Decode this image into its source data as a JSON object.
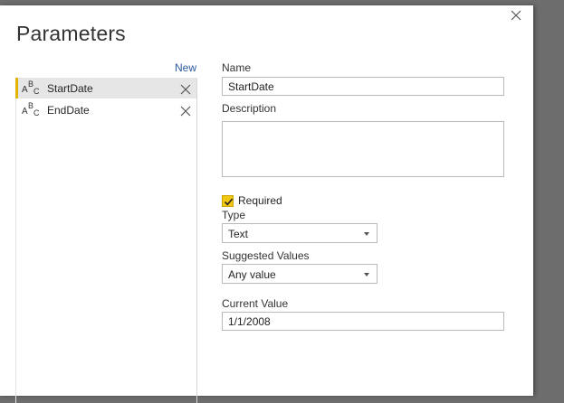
{
  "dialog": {
    "title": "Parameters",
    "new_label": "New"
  },
  "parameters": [
    {
      "name": "StartDate",
      "type_icon": "abc-text-icon",
      "selected": true
    },
    {
      "name": "EndDate",
      "type_icon": "abc-text-icon",
      "selected": false
    }
  ],
  "form": {
    "name_label": "Name",
    "name_value": "StartDate",
    "description_label": "Description",
    "description_value": "",
    "required_label": "Required",
    "required_checked": true,
    "type_label": "Type",
    "type_value": "Text",
    "suggested_label": "Suggested Values",
    "suggested_value": "Any value",
    "current_label": "Current Value",
    "current_value": "1/1/2008"
  },
  "icons": {
    "abc_a": "A",
    "abc_b": "B",
    "abc_c": "C"
  },
  "colors": {
    "accent": "#f2c811",
    "link": "#2c5aa0",
    "selection": "#e6e6e6"
  }
}
